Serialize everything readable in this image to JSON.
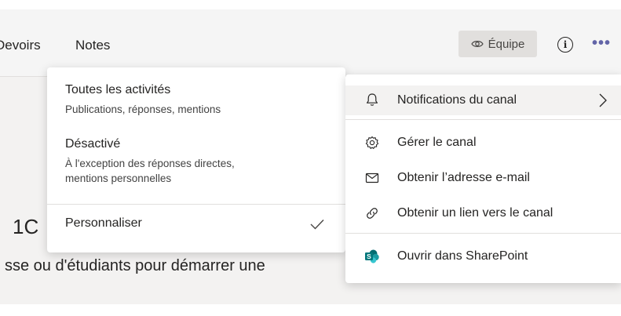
{
  "tabs": {
    "devoirs": "Devoirs",
    "notes": "Notes"
  },
  "header": {
    "team_label": "Équipe"
  },
  "background": {
    "heading": "1C",
    "text": "sse ou d'étudiants pour démarrer une"
  },
  "notification_options": {
    "all": {
      "title": "Toutes les activités",
      "description": "Publications, réponses, mentions"
    },
    "off": {
      "title": "Désactivé",
      "description_line1": "À l'exception des réponses directes,",
      "description_line2": "mentions personnelles"
    },
    "custom": {
      "title": "Personnaliser",
      "selected": true
    }
  },
  "channel_menu": {
    "items": [
      {
        "label": "Notifications du canal",
        "icon": "bell-icon"
      },
      {
        "label": "Gérer le canal",
        "icon": "gear-icon"
      },
      {
        "label": "Obtenir l’adresse e-mail",
        "icon": "envelope-icon"
      },
      {
        "label": "Obtenir un lien vers le canal",
        "icon": "link-icon"
      },
      {
        "label": "Ouvrir dans SharePoint",
        "icon": "sharepoint-icon"
      }
    ]
  },
  "colors": {
    "accent": "#6264a7",
    "sharepoint_dark": "#03787c",
    "sharepoint_light": "#37c6d0"
  }
}
